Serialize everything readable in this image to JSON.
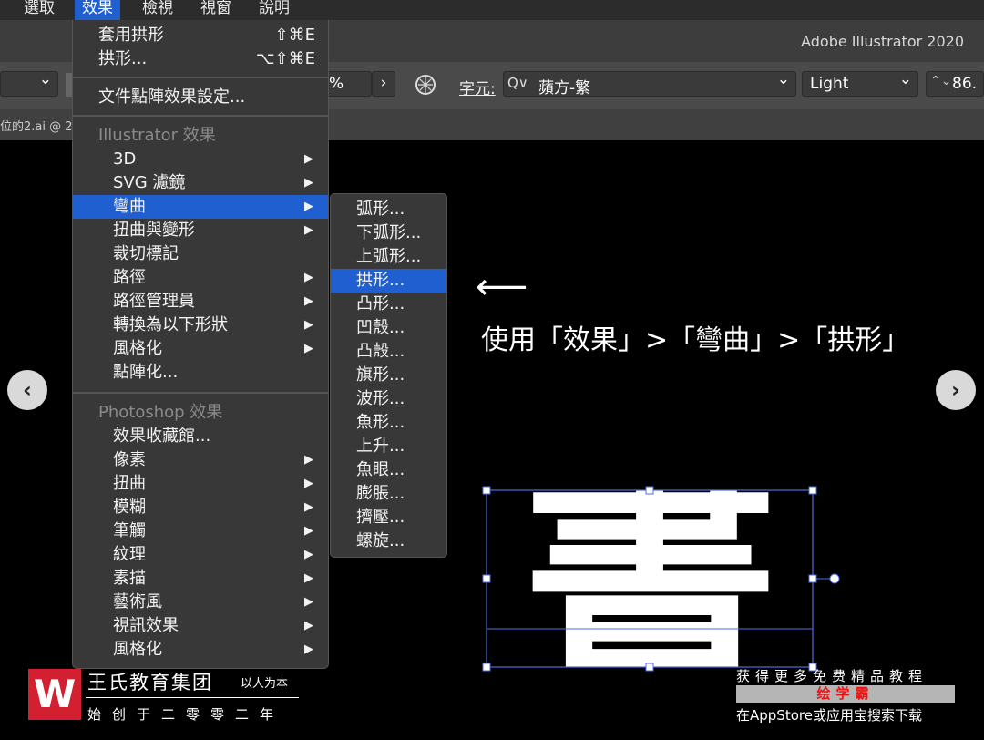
{
  "menubar": {
    "items": [
      "選取",
      "效果",
      "檢視",
      "視窗",
      "說明"
    ]
  },
  "app": {
    "title": "Adobe Illustrator 2020"
  },
  "controlbar": {
    "percent_suffix": "%",
    "character_label": "字元:",
    "search_glyph": "Q∨",
    "font_name": "蘋方-繁",
    "font_style": "Light",
    "font_size": "86.",
    "chevron_down": "⌄",
    "chevron_right": "›",
    "stepper": "⌃⌄"
  },
  "tab": {
    "document_name": "位的2.ai @ 2"
  },
  "effect_menu": {
    "apply_last": {
      "label": "套用拱形",
      "shortcut": "⇧⌘E"
    },
    "last_effect": {
      "label": "拱形...",
      "shortcut": "⌥⇧⌘E"
    },
    "raster_settings": "文件點陣效果設定...",
    "illustrator_header": "Illustrator 效果",
    "illustrator_items": [
      {
        "label": "3D",
        "submenu": true
      },
      {
        "label": "SVG 濾鏡",
        "submenu": true
      },
      {
        "label": "彎曲",
        "submenu": true
      },
      {
        "label": "扭曲與變形",
        "submenu": true
      },
      {
        "label": "裁切標記",
        "submenu": false
      },
      {
        "label": "路徑",
        "submenu": true
      },
      {
        "label": "路徑管理員",
        "submenu": true
      },
      {
        "label": "轉換為以下形狀",
        "submenu": true
      },
      {
        "label": "風格化",
        "submenu": true
      },
      {
        "label": "點陣化...",
        "submenu": false
      }
    ],
    "photoshop_header": "Photoshop 效果",
    "photoshop_items": [
      {
        "label": "效果收藏館...",
        "submenu": false
      },
      {
        "label": "像素",
        "submenu": true
      },
      {
        "label": "扭曲",
        "submenu": true
      },
      {
        "label": "模糊",
        "submenu": true
      },
      {
        "label": "筆觸",
        "submenu": true
      },
      {
        "label": "紋理",
        "submenu": true
      },
      {
        "label": "素描",
        "submenu": true
      },
      {
        "label": "藝術風",
        "submenu": true
      },
      {
        "label": "視訊效果",
        "submenu": true
      },
      {
        "label": "風格化",
        "submenu": true
      }
    ],
    "arrow_glyph": "▶"
  },
  "warp_submenu": {
    "items": [
      "弧形...",
      "下弧形...",
      "上弧形...",
      "拱形...",
      "凸形...",
      "凹殼...",
      "凸殼...",
      "旗形...",
      "波形...",
      "魚形...",
      "上升...",
      "魚眼...",
      "膨脹...",
      "擠壓...",
      "螺旋..."
    ],
    "selected": "拱形..."
  },
  "annotation": {
    "arrow": "⟵",
    "text": "使用「效果」>「彎曲」>「拱形」"
  },
  "canvas": {
    "glyph": "書"
  },
  "nav": {
    "prev": "‹",
    "next": "›"
  },
  "branding": {
    "logo_letter": "W",
    "name": "王氏教育集团",
    "motto": "以人为本",
    "since": "始创于二零零二年"
  },
  "promo": {
    "line1": "获得更多免费精品教程",
    "highlight": "绘学霸",
    "line3": "在AppStore或应用宝搜索下载"
  },
  "colors": {
    "selection": "#1f5fd0",
    "brand_red": "#d22030",
    "bbox": "#4a6fe0"
  }
}
